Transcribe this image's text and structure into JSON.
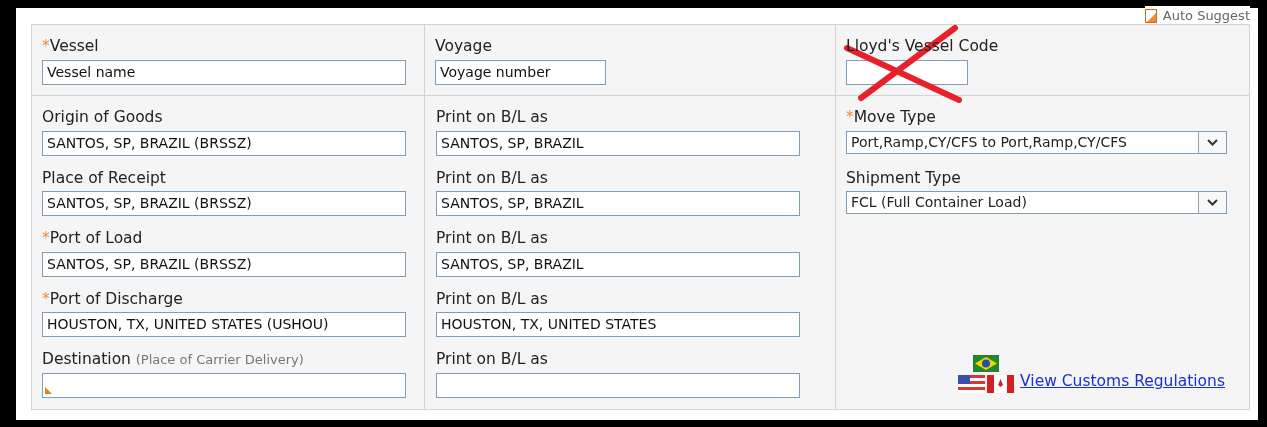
{
  "auto_suggest": "Auto Suggest",
  "header_fields": [
    {
      "label": "Vessel",
      "required_mark": "*",
      "value": "Vessel name"
    },
    {
      "label": "Voyage",
      "value": "Voyage number"
    },
    {
      "label": "Lloyd's Vessel Code",
      "crossed_out": true
    }
  ],
  "locations": [
    {
      "label": "Origin of Goods",
      "value": "SANTOS, SP, BRAZIL (BRSSZ)",
      "print_label": "Print on B/L as",
      "print_value": "SANTOS, SP, BRAZIL"
    },
    {
      "label": "Place of Receipt",
      "value": "SANTOS, SP, BRAZIL (BRSSZ)",
      "print_label": "Print on B/L as",
      "print_value": "SANTOS, SP, BRAZIL"
    },
    {
      "label": "Port of Load",
      "required_mark": "*",
      "value": "SANTOS, SP, BRAZIL (BRSSZ)",
      "print_label": "Print on B/L as",
      "print_value": "SANTOS, SP, BRAZIL"
    },
    {
      "label": "Port of Discharge",
      "required_mark": "*",
      "value": "HOUSTON, TX, UNITED STATES (USHOU)",
      "print_label": "Print on B/L as",
      "print_value": "HOUSTON, TX, UNITED STATES"
    },
    {
      "label": "Destination",
      "hint": "(Place of Carrier Delivery)",
      "auto_suggest": true,
      "print_label": "Print on B/L as"
    }
  ],
  "selects": [
    {
      "label": "Move Type",
      "required_mark": "*",
      "value": "Port,Ramp,CY/CFS to Port,Ramp,CY/CFS"
    },
    {
      "label": "Shipment Type",
      "value": "FCL (Full Container Load)"
    }
  ],
  "customs_link": "View Customs Regulations"
}
